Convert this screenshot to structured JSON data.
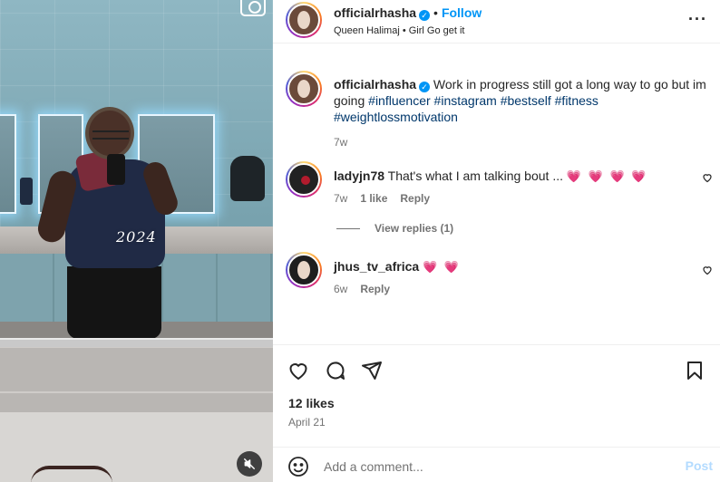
{
  "post": {
    "media": {
      "overlay_text": "2024",
      "icons": [
        "camera-icon",
        "mute-icon"
      ]
    },
    "header": {
      "username": "officialrhasha",
      "follow_label": "Follow",
      "subtitle": "Queen Halimaj • Girl Go get it"
    },
    "caption": {
      "username": "officialrhasha",
      "text": "Work in progress still got a long way to go but im going",
      "hashtags": [
        "#influencer",
        "#instagram",
        "#bestself",
        "#fitness",
        "#weightlossmotivation"
      ],
      "time": "7w"
    },
    "comments": [
      {
        "username": "ladyjn78",
        "text": "That's what I am talking bout ...",
        "hearts": "💗 💗 💗 💗",
        "time": "7w",
        "likes_label": "1 like",
        "reply_label": "Reply",
        "view_replies": "View replies (1)"
      },
      {
        "username": "jhus_tv_africa",
        "text": "",
        "hearts": "💗 💗",
        "time": "6w",
        "reply_label": "Reply"
      }
    ],
    "likes": "12 likes",
    "date": "April 21",
    "add_comment": {
      "placeholder": "Add a comment...",
      "post_label": "Post"
    }
  },
  "colors": {
    "accent": "#0095f6",
    "text": "#262626",
    "muted": "#737373",
    "hashtag": "#00376b",
    "heart": "#e0245e"
  }
}
